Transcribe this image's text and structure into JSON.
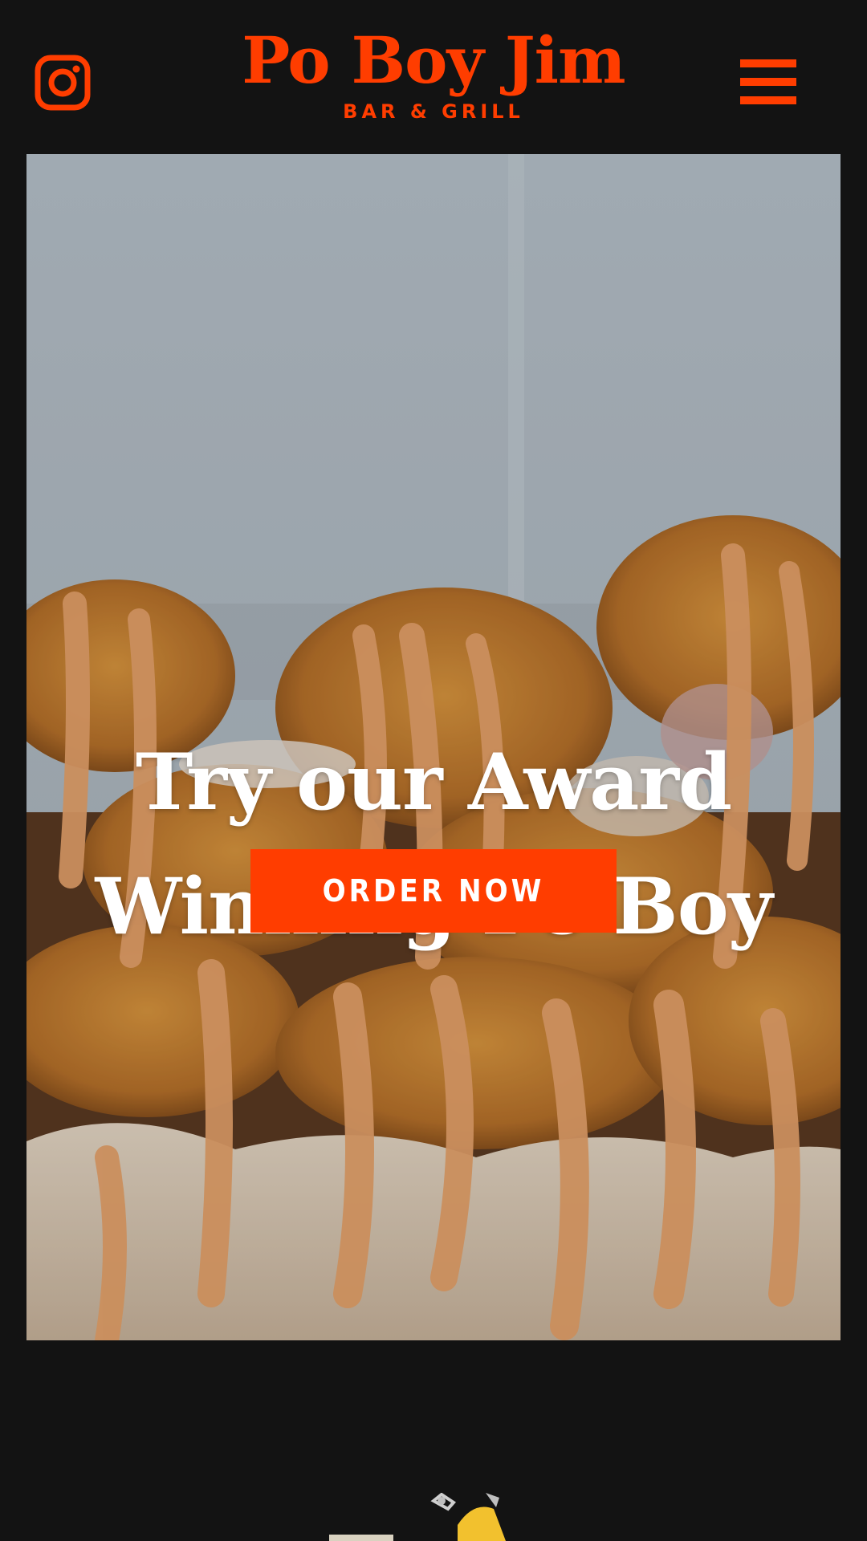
{
  "header": {
    "instagram_icon": "instagram-icon",
    "logo": {
      "name": "Po Boy Jim",
      "subtitle": "BAR & GRILL"
    },
    "menu_icon": "hamburger-menu-icon"
  },
  "hero": {
    "title": "Try our Award Winning Po Boy",
    "cta_label": "ORDER NOW"
  },
  "colors": {
    "background": "#131313",
    "accent": "#ff3d00",
    "text_light": "#ffffff"
  }
}
